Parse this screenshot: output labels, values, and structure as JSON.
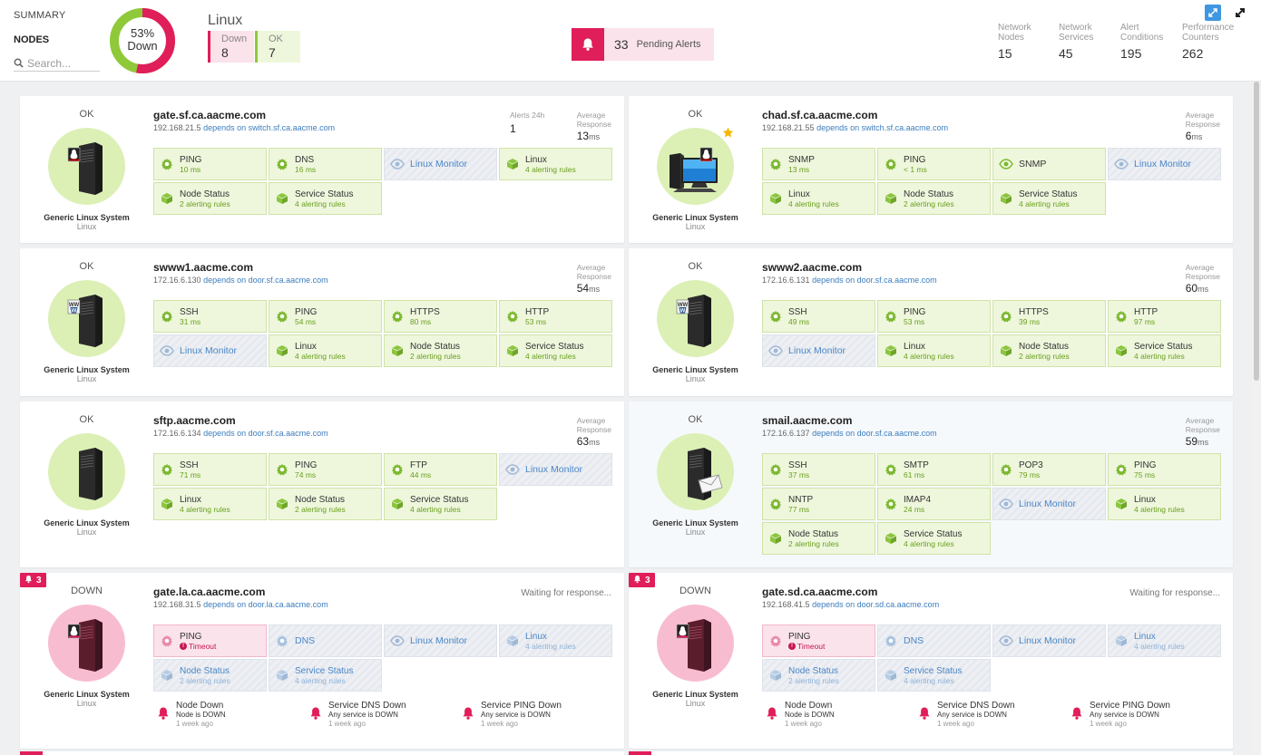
{
  "nav": {
    "summary": "SUMMARY",
    "nodes": "NODES",
    "search_placeholder": "Search..."
  },
  "donut": {
    "percent_label": "53%",
    "status_label": "Down",
    "down_fraction": 0.53
  },
  "group": {
    "title": "Linux",
    "down_label": "Down",
    "down_count": "8",
    "ok_label": "OK",
    "ok_count": "7"
  },
  "pending_alerts": {
    "count": "33",
    "label": "Pending Alerts"
  },
  "stats": [
    {
      "label1": "Network",
      "label2": "Nodes",
      "value": "15"
    },
    {
      "label1": "Network",
      "label2": "Services",
      "value": "45"
    },
    {
      "label1": "Alert",
      "label2": "Conditions",
      "value": "195"
    },
    {
      "label1": "Performance",
      "label2": "Counters",
      "value": "262"
    }
  ],
  "colors": {
    "down": "#e01e5a",
    "ok": "#8fc93a",
    "ok_bg": "#dcf0b6",
    "down_bg": "#f8bcd0",
    "link": "#3c7dbd"
  },
  "common": {
    "type": "Generic Linux System",
    "os": "Linux",
    "depends": "depends on",
    "avg_resp_1": "Average",
    "avg_resp_2": "Response",
    "ms": "ms",
    "alerts24": "Alerts 24h",
    "waiting": "Waiting for response..."
  },
  "nodes": [
    {
      "status": "OK",
      "name": "gate.sf.ca.aacme.com",
      "ip": "192.168.21.5",
      "dep": "switch.sf.ca.aacme.com",
      "resp": "13",
      "alerts24": "1",
      "icon": "linux-server-icon",
      "tiles": [
        {
          "kind": "ok",
          "icon": "gear-icon",
          "name": "PING",
          "sub": "10 ms"
        },
        {
          "kind": "ok",
          "icon": "gear-icon",
          "name": "DNS",
          "sub": "16 ms"
        },
        {
          "kind": "gray",
          "icon": "eye-icon",
          "name": "Linux Monitor",
          "sub": ""
        },
        {
          "kind": "ok",
          "icon": "cube-icon",
          "name": "Linux",
          "sub": "4 alerting rules"
        },
        {
          "kind": "ok",
          "icon": "cube-icon",
          "name": "Node Status",
          "sub": "2 alerting rules"
        },
        {
          "kind": "ok",
          "icon": "cube-icon",
          "name": "Service Status",
          "sub": "4 alerting rules"
        }
      ]
    },
    {
      "status": "OK",
      "name": "chad.sf.ca.aacme.com",
      "ip": "192.168.21.55",
      "dep": "switch.sf.ca.aacme.com",
      "resp": "6",
      "icon": "workstation-icon",
      "star": true,
      "tiles": [
        {
          "kind": "ok",
          "icon": "gear-icon",
          "name": "SNMP",
          "sub": "13 ms"
        },
        {
          "kind": "ok",
          "icon": "gear-icon",
          "name": "PING",
          "sub": "< 1 ms"
        },
        {
          "kind": "ok",
          "icon": "eye-icon",
          "name": "SNMP",
          "sub": ""
        },
        {
          "kind": "gray",
          "icon": "eye-icon",
          "name": "Linux Monitor",
          "sub": ""
        },
        {
          "kind": "ok",
          "icon": "cube-icon",
          "name": "Linux",
          "sub": "4 alerting rules"
        },
        {
          "kind": "ok",
          "icon": "cube-icon",
          "name": "Node Status",
          "sub": "2 alerting rules"
        },
        {
          "kind": "ok",
          "icon": "cube-icon",
          "name": "Service Status",
          "sub": "4 alerting rules"
        }
      ]
    },
    {
      "status": "OK",
      "name": "swww1.aacme.com",
      "ip": "172.16.6.130",
      "dep": "door.sf.ca.aacme.com",
      "resp": "54",
      "icon": "web-server-icon",
      "tiles": [
        {
          "kind": "ok",
          "icon": "gear-icon",
          "name": "SSH",
          "sub": "31 ms"
        },
        {
          "kind": "ok",
          "icon": "gear-icon",
          "name": "PING",
          "sub": "54 ms"
        },
        {
          "kind": "ok",
          "icon": "gear-icon",
          "name": "HTTPS",
          "sub": "80 ms"
        },
        {
          "kind": "ok",
          "icon": "gear-icon",
          "name": "HTTP",
          "sub": "53 ms"
        },
        {
          "kind": "gray",
          "icon": "eye-icon",
          "name": "Linux Monitor",
          "sub": ""
        },
        {
          "kind": "ok",
          "icon": "cube-icon",
          "name": "Linux",
          "sub": "4 alerting rules"
        },
        {
          "kind": "ok",
          "icon": "cube-icon",
          "name": "Node Status",
          "sub": "2 alerting rules"
        },
        {
          "kind": "ok",
          "icon": "cube-icon",
          "name": "Service Status",
          "sub": "4 alerting rules"
        }
      ]
    },
    {
      "status": "OK",
      "name": "swww2.aacme.com",
      "ip": "172.16.6.131",
      "dep": "door.sf.ca.aacme.com",
      "resp": "60",
      "icon": "web-server-icon",
      "tiles": [
        {
          "kind": "ok",
          "icon": "gear-icon",
          "name": "SSH",
          "sub": "49 ms"
        },
        {
          "kind": "ok",
          "icon": "gear-icon",
          "name": "PING",
          "sub": "53 ms"
        },
        {
          "kind": "ok",
          "icon": "gear-icon",
          "name": "HTTPS",
          "sub": "39 ms"
        },
        {
          "kind": "ok",
          "icon": "gear-icon",
          "name": "HTTP",
          "sub": "97 ms"
        },
        {
          "kind": "gray",
          "icon": "eye-icon",
          "name": "Linux Monitor",
          "sub": ""
        },
        {
          "kind": "ok",
          "icon": "cube-icon",
          "name": "Linux",
          "sub": "4 alerting rules"
        },
        {
          "kind": "ok",
          "icon": "cube-icon",
          "name": "Node Status",
          "sub": "2 alerting rules"
        },
        {
          "kind": "ok",
          "icon": "cube-icon",
          "name": "Service Status",
          "sub": "4 alerting rules"
        }
      ]
    },
    {
      "status": "OK",
      "name": "sftp.aacme.com",
      "ip": "172.16.6.134",
      "dep": "door.sf.ca.aacme.com",
      "resp": "63",
      "icon": "server-icon",
      "tiles": [
        {
          "kind": "ok",
          "icon": "gear-icon",
          "name": "SSH",
          "sub": "71 ms"
        },
        {
          "kind": "ok",
          "icon": "gear-icon",
          "name": "PING",
          "sub": "74 ms"
        },
        {
          "kind": "ok",
          "icon": "gear-icon",
          "name": "FTP",
          "sub": "44 ms"
        },
        {
          "kind": "gray",
          "icon": "eye-icon",
          "name": "Linux Monitor",
          "sub": ""
        },
        {
          "kind": "ok",
          "icon": "cube-icon",
          "name": "Linux",
          "sub": "4 alerting rules"
        },
        {
          "kind": "ok",
          "icon": "cube-icon",
          "name": "Node Status",
          "sub": "2 alerting rules"
        },
        {
          "kind": "ok",
          "icon": "cube-icon",
          "name": "Service Status",
          "sub": "4 alerting rules"
        }
      ]
    },
    {
      "status": "OK",
      "name": "smail.aacme.com",
      "ip": "172.16.6.137",
      "dep": "door.sf.ca.aacme.com",
      "resp": "59",
      "icon": "mail-server-icon",
      "bluish": true,
      "tiles": [
        {
          "kind": "ok",
          "icon": "gear-icon",
          "name": "SSH",
          "sub": "37 ms"
        },
        {
          "kind": "ok",
          "icon": "gear-icon",
          "name": "SMTP",
          "sub": "61 ms"
        },
        {
          "kind": "ok",
          "icon": "gear-icon",
          "name": "POP3",
          "sub": "79 ms"
        },
        {
          "kind": "ok",
          "icon": "gear-icon",
          "name": "PING",
          "sub": "75 ms"
        },
        {
          "kind": "ok",
          "icon": "gear-icon",
          "name": "NNTP",
          "sub": "77 ms"
        },
        {
          "kind": "ok",
          "icon": "gear-icon",
          "name": "IMAP4",
          "sub": "24 ms"
        },
        {
          "kind": "gray",
          "icon": "eye-icon",
          "name": "Linux Monitor",
          "sub": ""
        },
        {
          "kind": "ok",
          "icon": "cube-icon",
          "name": "Linux",
          "sub": "4 alerting rules"
        },
        {
          "kind": "ok",
          "icon": "cube-icon",
          "name": "Node Status",
          "sub": "2 alerting rules"
        },
        {
          "kind": "ok",
          "icon": "cube-icon",
          "name": "Service Status",
          "sub": "4 alerting rules"
        }
      ]
    },
    {
      "status": "DOWN",
      "name": "gate.la.ca.aacme.com",
      "ip": "192.168.31.5",
      "dep": "door.la.ca.aacme.com",
      "down": true,
      "badge": "3",
      "icon": "linux-server-icon",
      "tiles": [
        {
          "kind": "red",
          "icon": "gear-icon",
          "name": "PING",
          "sub": "Timeout"
        },
        {
          "kind": "gray",
          "icon": "gear-icon",
          "name": "DNS",
          "sub": ""
        },
        {
          "kind": "gray",
          "icon": "eye-icon",
          "name": "Linux Monitor",
          "sub": ""
        },
        {
          "kind": "gray",
          "icon": "cube-icon",
          "name": "Linux",
          "sub": "4 alerting rules"
        },
        {
          "kind": "gray",
          "icon": "cube-icon",
          "name": "Node Status",
          "sub": "2 alerting rules"
        },
        {
          "kind": "gray",
          "icon": "cube-icon",
          "name": "Service Status",
          "sub": "4 alerting rules"
        }
      ],
      "alerts": [
        {
          "title": "Node Down",
          "sub": "Node is DOWN",
          "when": "1 week ago"
        },
        {
          "title": "Service DNS Down",
          "sub": "Any service is DOWN",
          "when": "1 week ago"
        },
        {
          "title": "Service PING Down",
          "sub": "Any service is DOWN",
          "when": "1 week ago"
        }
      ]
    },
    {
      "status": "DOWN",
      "name": "gate.sd.ca.aacme.com",
      "ip": "192.168.41.5",
      "dep": "door.sd.ca.aacme.com",
      "down": true,
      "badge": "3",
      "icon": "linux-server-icon",
      "tiles": [
        {
          "kind": "red",
          "icon": "gear-icon",
          "name": "PING",
          "sub": "Timeout"
        },
        {
          "kind": "gray",
          "icon": "gear-icon",
          "name": "DNS",
          "sub": ""
        },
        {
          "kind": "gray",
          "icon": "eye-icon",
          "name": "Linux Monitor",
          "sub": ""
        },
        {
          "kind": "gray",
          "icon": "cube-icon",
          "name": "Linux",
          "sub": "4 alerting rules"
        },
        {
          "kind": "gray",
          "icon": "cube-icon",
          "name": "Node Status",
          "sub": "2 alerting rules"
        },
        {
          "kind": "gray",
          "icon": "cube-icon",
          "name": "Service Status",
          "sub": "4 alerting rules"
        }
      ],
      "alerts": [
        {
          "title": "Node Down",
          "sub": "Node is DOWN",
          "when": "1 week ago"
        },
        {
          "title": "Service DNS Down",
          "sub": "Any service is DOWN",
          "when": "1 week ago"
        },
        {
          "title": "Service PING Down",
          "sub": "Any service is DOWN",
          "when": "1 week ago"
        }
      ]
    }
  ]
}
